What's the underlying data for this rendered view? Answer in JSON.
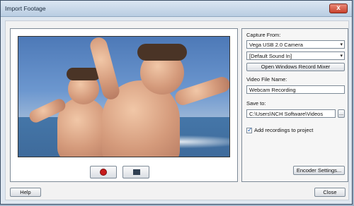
{
  "window": {
    "title": "Import Footage",
    "close_glyph": "x"
  },
  "capture": {
    "capture_from_label": "Capture From:",
    "video_device": "Vega USB 2.0 Camera",
    "audio_device": "[Default Sound In]",
    "open_mixer_label": "Open Windows Record Mixer"
  },
  "file": {
    "video_file_name_label": "Video File Name:",
    "video_file_name_value": "Webcam Recording",
    "save_to_label": "Save to:",
    "save_to_value": "C:\\Users\\NCH Software\\Videos",
    "browse_label": "...",
    "add_recordings_label": "Add recordings to project",
    "add_recordings_checked": true
  },
  "buttons": {
    "encoder_settings": "Encoder Settings...",
    "help": "Help",
    "close": "Close"
  },
  "icons": {
    "record": "record-icon",
    "stop": "stop-icon",
    "dropdown": "chevron-down-icon"
  }
}
